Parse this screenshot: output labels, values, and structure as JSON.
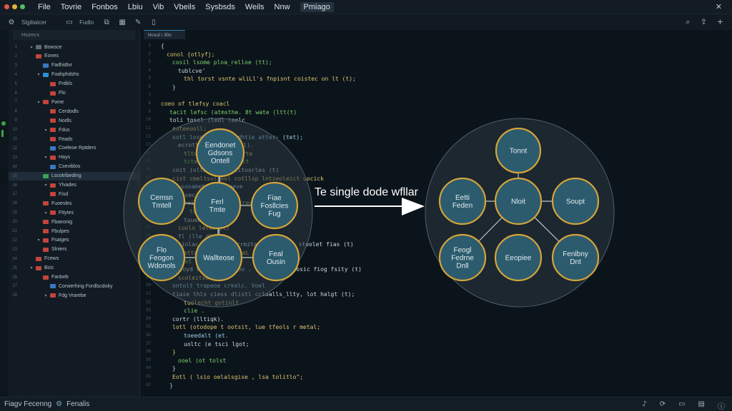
{
  "menubar": {
    "items": [
      "File",
      "Tovrie",
      "Fonbos",
      "Lbiu",
      "Vib",
      "Vbeils",
      "Sysbsds",
      "Weils",
      "Nnw",
      "Pmiago"
    ],
    "active_index": 9
  },
  "toolbar": {
    "path_label": "Slgibaicer",
    "mode_label": "Fudlo"
  },
  "editor": {
    "tab_label": "Hcoul i illio"
  },
  "sidebar": {
    "header": "Hozecs",
    "items": [
      {
        "label": "Bowsce",
        "lineno": "1"
      },
      {
        "label": "Eones",
        "lineno": "2"
      },
      {
        "label": "Fadhidtvr",
        "lineno": "3"
      },
      {
        "label": "Foahphdshs",
        "lineno": "4"
      },
      {
        "label": "Frdkls",
        "lineno": "5"
      },
      {
        "label": "Flo",
        "lineno": "6"
      },
      {
        "label": "Fwne",
        "lineno": "7"
      },
      {
        "label": "Cerdodls",
        "lineno": "8"
      },
      {
        "label": "Nodls",
        "lineno": "9"
      },
      {
        "label": "Fdus",
        "lineno": "10"
      },
      {
        "label": "Feads",
        "lineno": "11"
      },
      {
        "label": "Coeleoe Rptders",
        "lineno": "12"
      },
      {
        "label": "Hays",
        "lineno": "13"
      },
      {
        "label": "Cseviblos",
        "lineno": "14"
      },
      {
        "label": "Lscotribeding",
        "lineno": "15"
      },
      {
        "label": "Ylvades",
        "lineno": "16"
      },
      {
        "label": "Fisd",
        "lineno": "17"
      },
      {
        "label": "Fuoesles",
        "lineno": "18"
      },
      {
        "label": "Fttytes",
        "lineno": "19"
      },
      {
        "label": "Fbaeonig",
        "lineno": "20"
      },
      {
        "label": "Fbulpes",
        "lineno": "21"
      },
      {
        "label": "Fsaiges",
        "lineno": "22"
      },
      {
        "label": "Slniers",
        "lineno": "23"
      },
      {
        "label": "Fcews",
        "lineno": "24"
      },
      {
        "label": "Bcic",
        "lineno": "25"
      },
      {
        "label": "Fanbeb",
        "lineno": "26"
      },
      {
        "label": "Corwerhing Fordlscdoky",
        "lineno": "27"
      },
      {
        "label": "Fdg Vrarebe",
        "lineno": "28"
      }
    ]
  },
  "code_lines": [
    {
      "n": "1",
      "text": "{"
    },
    {
      "n": "2",
      "text": "conol {otlyfj;"
    },
    {
      "n": "3",
      "text": "cosil lsome ploa_relloe (tt);"
    },
    {
      "n": "4",
      "text": "tublcve'"
    },
    {
      "n": "5",
      "text": "thl torst vsnte wliLl's fnpisnt coistec on lt (t);"
    },
    {
      "n": "6",
      "text": "}"
    },
    {
      "n": "7",
      "text": ""
    },
    {
      "n": "8",
      "text": "coeo of tlefsy coacl"
    },
    {
      "n": "9",
      "text": "tacit lefsc (atmsthe. 8t wate (ltt(t)"
    },
    {
      "n": "10",
      "text": "toli tosel (ledl teolc"
    },
    {
      "n": "11",
      "text": "coteeuoll;"
    },
    {
      "n": "12",
      "text": "sotl losnelt contatdhtie atter- (tet);"
    },
    {
      "n": "13",
      "text": "ecrotle     nedt. tec (l)."
    },
    {
      "n": "14",
      "text": "tltu      Naeiis ordtarte"
    },
    {
      "n": "15",
      "text": "tctec  lpmoovesoiect"
    },
    {
      "n": "16",
      "text": "coit  (ollel (t)  (tlitoorles (t)"
    },
    {
      "n": "17",
      "text": "cist   cmeltsvl  ool cotllsp lntzeoleict uocick"
    },
    {
      "n": "18",
      "text": "sooamet (tt) taeve"
    },
    {
      "n": "19",
      "text": "clsec               ert)"
    },
    {
      "n": "20",
      "text": "laite       fruvesclettrect"
    },
    {
      "n": "21",
      "text": "tatr  oeeaue."
    },
    {
      "n": "22",
      "text": "touee.lidss"
    },
    {
      "n": "23",
      "text": "cuolo  leloo (t)"
    },
    {
      "n": "24",
      "text": "fl (lle    dlnoe)"
    },
    {
      "n": "25",
      "text": "tinlac  lwocentuo  rrmzta (lt lielie steolet fias (t)"
    },
    {
      "n": "26",
      "text": "ettolo      ocoat  gifoeL"
    },
    {
      "n": "27",
      "text": "tost  (a)"
    },
    {
      "n": "28",
      "text": "tatoyd    Veiiet  cfeoloo  . (ot ycrlsc uosic fiog fsity (t)"
    },
    {
      "n": "29",
      "text": "scoleitve    alyr."
    },
    {
      "n": "30",
      "text": "ontolt   trapeoe  crkelc.   Voel"
    },
    {
      "n": "31",
      "text": "tiaie   thls  ciess dlistl   ccloalls_llty, lot halgt (t);"
    },
    {
      "n": "32",
      "text": "tuolecht gotinlt"
    },
    {
      "n": "33",
      "text": "clie ."
    },
    {
      "n": "34",
      "text": "cortr (lltiqk)."
    },
    {
      "n": "35",
      "text": "lotl (otodope  t ootsit, lue  tfeols  r  metal;"
    },
    {
      "n": "36",
      "text": "toeedalt   (et."
    },
    {
      "n": "37",
      "text": "uoltc  (e  tsci lgot;"
    },
    {
      "n": "38",
      "text": "}"
    },
    {
      "n": "39",
      "text": "ooel (ot tolst"
    },
    {
      "n": "40",
      "text": "}"
    },
    {
      "n": "41",
      "text": "Eotl  (  lsio oelalsgise , lsa tolitlo\";"
    },
    {
      "n": "42",
      "text": "}"
    }
  ],
  "diagram": {
    "caption": "Te single dode wfllar",
    "left_cluster": {
      "nodes": [
        {
          "label": [
            "Eendonet",
            "Gdsons",
            "Ontell"
          ]
        },
        {
          "label": [
            "Cemsn",
            "Tmtell"
          ]
        },
        {
          "label": [
            "Ferl",
            "Tmte"
          ]
        },
        {
          "label": [
            "Fiae",
            "Fosllcies",
            "Fug"
          ]
        },
        {
          "label": [
            "Flo",
            "Feogon",
            "Wdonols"
          ]
        },
        {
          "label": [
            "Wallteose"
          ]
        },
        {
          "label": [
            "Feal",
            "Ousin"
          ]
        }
      ]
    },
    "right_cluster": {
      "nodes": [
        {
          "label": [
            "Tonnt"
          ]
        },
        {
          "label": [
            "Eetti",
            "Feden"
          ]
        },
        {
          "label": [
            "Nloit"
          ]
        },
        {
          "label": [
            "Soupt"
          ]
        },
        {
          "label": [
            "Feogl",
            "Fedrne",
            "Dnll"
          ]
        },
        {
          "label": [
            "Eeopiee"
          ]
        },
        {
          "label": [
            "Fenlbny",
            "Dnt"
          ]
        }
      ]
    }
  },
  "statusbar": {
    "left_text": "Fiagv Fecenng",
    "right_text": "Fenalis"
  },
  "colors": {
    "node_fill": "#2c5b6e",
    "node_stroke": "#d4a43a",
    "cluster_fill": "#2a3640",
    "keyword": "#d6c36b",
    "string": "#7fd16d",
    "accent": "#2e7ab3"
  }
}
